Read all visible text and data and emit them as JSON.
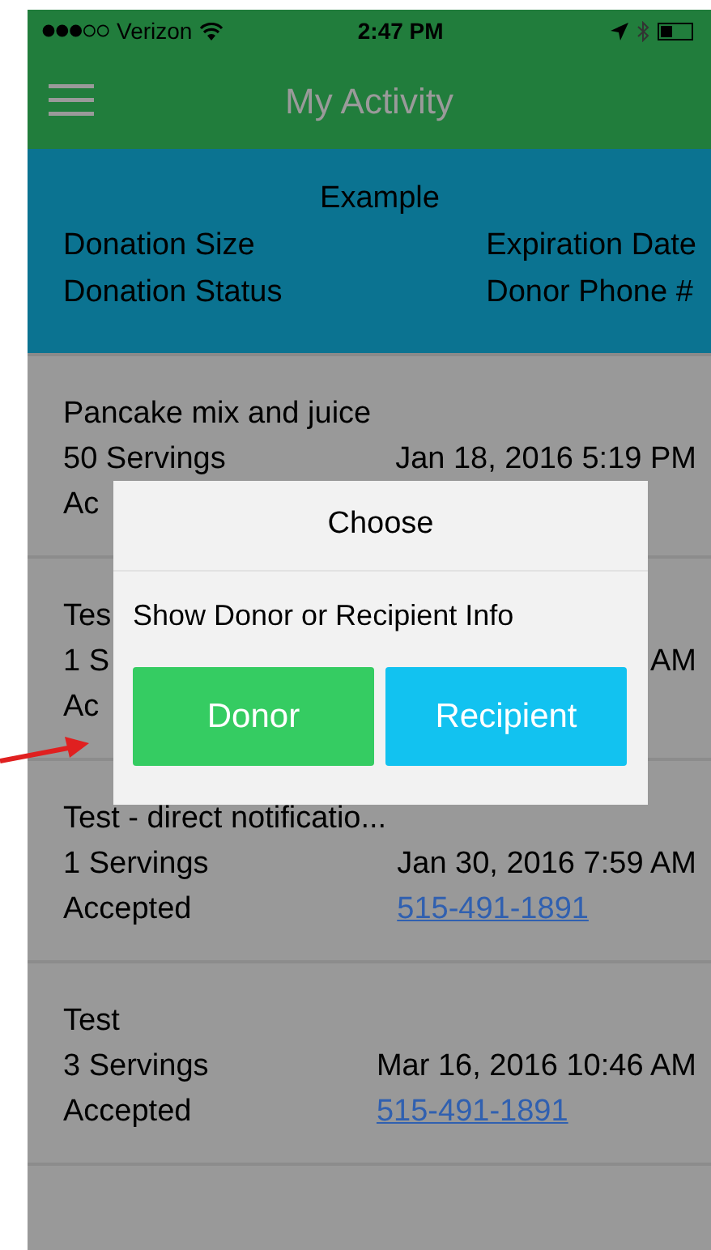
{
  "status_bar": {
    "carrier": "Verizon",
    "time": "2:47 PM"
  },
  "nav": {
    "title": "My Activity"
  },
  "legend": {
    "title": "Example",
    "left": [
      "Donation Size",
      "Donation Status"
    ],
    "right": [
      "Expiration Date",
      "Donor Phone #"
    ]
  },
  "rows": [
    {
      "title": "Pancake mix and juice",
      "servings": "50 Servings",
      "date": "Jan 18, 2016 5:19 PM",
      "status": "Ac"
    },
    {
      "title": "Tes",
      "servings": "1 S",
      "date": "AM",
      "status": "Ac"
    },
    {
      "title": "Test - direct notificatio...",
      "servings": "1 Servings",
      "date": "Jan 30, 2016 7:59 AM",
      "status": "Accepted",
      "phone": "515-491-1891"
    },
    {
      "title": "Test",
      "servings": "3 Servings",
      "date": "Mar 16, 2016 10:46 AM",
      "status": "Accepted",
      "phone": "515-491-1891"
    }
  ],
  "dialog": {
    "title": "Choose",
    "message": "Show Donor or Recipient Info",
    "buttons": [
      {
        "label": "Donor",
        "color": "#35cc62"
      },
      {
        "label": "Recipient",
        "color": "#12c2f0"
      }
    ]
  }
}
